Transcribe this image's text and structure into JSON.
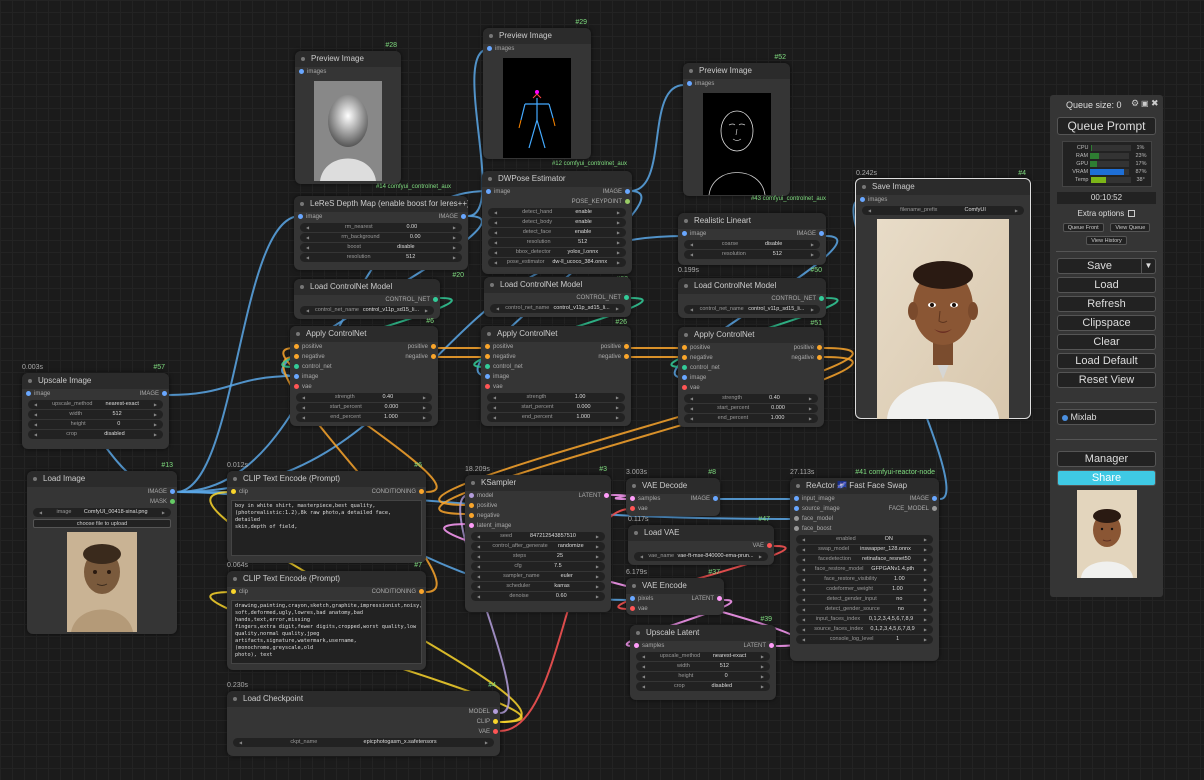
{
  "nodes": {
    "preview28": {
      "id": "#28",
      "title": "Preview Image",
      "input": "images",
      "footer": "#14 comfyui_controlnet_aux"
    },
    "preview29": {
      "id": "#29",
      "title": "Preview Image",
      "input": "images",
      "footer": "#12 comfyui_controlnet_aux"
    },
    "preview52": {
      "id": "#52",
      "title": "Preview Image",
      "input": "images",
      "footer": "#43 comfyui_controlnet_aux"
    },
    "leres": {
      "id": "#20",
      "title": "LeReS Depth Map (enable boost for leres++)",
      "input": "image",
      "output": "IMAGE",
      "widgets": [
        [
          "rm_nearest",
          "0.00"
        ],
        [
          "rm_background",
          "0.00"
        ],
        [
          "boost",
          "disable"
        ],
        [
          "resolution",
          "512"
        ]
      ]
    },
    "dwpose": {
      "id": "#22",
      "title": "DWPose Estimator",
      "input": "image",
      "outputs": [
        "IMAGE",
        "POSE_KEYPOINT"
      ],
      "widgets": [
        [
          "detect_hand",
          "enable"
        ],
        [
          "detect_body",
          "enable"
        ],
        [
          "detect_face",
          "enable"
        ],
        [
          "resolution",
          "512"
        ],
        [
          "bbox_detector",
          "yolox_l.onnx"
        ],
        [
          "pose_estimator",
          "dw-ll_ucoco_384.onnx"
        ]
      ]
    },
    "lineart": {
      "id": "#50",
      "time": "0.199s",
      "title": "Realistic Lineart",
      "input": "image",
      "output": "IMAGE",
      "widgets": [
        [
          "coarse",
          "disable"
        ],
        [
          "resolution",
          "512"
        ]
      ]
    },
    "cnload1": {
      "id": "#26",
      "title": "Load ControlNet Model",
      "output": "CONTROL_NET",
      "widget": [
        "control_net_name",
        "control_v11p_sd15_li..."
      ]
    },
    "cnload2": {
      "id": "#26",
      "title": "Load ControlNet Model",
      "output": "CONTROL_NET",
      "widget": [
        "control_net_name",
        "control_v11p_sd15_li..."
      ]
    },
    "cnload3": {
      "id": "#51",
      "title": "Load ControlNet Model",
      "output": "CONTROL_NET",
      "widget": [
        "control_net_name",
        "control_v11p_sd15_li..."
      ]
    },
    "apply1": {
      "id": "#6",
      "title": "Apply ControlNet",
      "inputs": [
        "positive",
        "negative",
        "control_net",
        "image",
        "vae"
      ],
      "outputs": [
        "positive",
        "negative"
      ],
      "widgets": [
        [
          "strength",
          "0.40"
        ],
        [
          "start_percent",
          "0.000"
        ],
        [
          "end_percent",
          "1.000"
        ]
      ]
    },
    "apply2": {
      "id": "#3",
      "title": "Apply ControlNet",
      "inputs": [
        "positive",
        "negative",
        "control_net",
        "image",
        "vae"
      ],
      "outputs": [
        "positive",
        "negative"
      ],
      "widgets": [
        [
          "strength",
          "1.00"
        ],
        [
          "start_percent",
          "0.000"
        ],
        [
          "end_percent",
          "1.000"
        ]
      ]
    },
    "apply3": {
      "id": "#8",
      "title": "Apply ControlNet",
      "inputs": [
        "positive",
        "negative",
        "control_net",
        "image",
        "vae"
      ],
      "outputs": [
        "positive",
        "negative"
      ],
      "widgets": [
        [
          "strength",
          "0.40"
        ],
        [
          "start_percent",
          "0.000"
        ],
        [
          "end_percent",
          "1.000"
        ]
      ]
    },
    "upscale": {
      "id": "#57",
      "time": "0.003s",
      "title": "Upscale Image",
      "input": "image",
      "output": "IMAGE",
      "widgets": [
        [
          "upscale_method",
          "nearest-exact"
        ],
        [
          "width",
          "512"
        ],
        [
          "height",
          "0"
        ],
        [
          "crop",
          "disabled"
        ]
      ]
    },
    "loadimg": {
      "id": "#13",
      "title": "Load Image",
      "outputs": [
        "IMAGE",
        "MASK"
      ],
      "widget": [
        "image",
        "ComfyUI_00418-sinal.png"
      ],
      "button": "choose file to upload"
    },
    "clip1": {
      "id": "#6",
      "time": "0.012s",
      "title": "CLIP Text Encode (Prompt)",
      "input": "clip",
      "output": "CONDITIONING",
      "text": "boy in white shirt, masterpiece,best quality,\n(photorealistic:1.2),8k raw photo,a detailed face, detailed\nskin,depth of field,"
    },
    "clip2": {
      "id": "#7",
      "time": "0.064s",
      "title": "CLIP Text Encode (Prompt)",
      "input": "clip",
      "output": "CONDITIONING",
      "text": "drawing,painting,crayon,sketch,graphite,impressionist,noisy,blurry,\nsoft,deformed,ugly,lowres,bad anatomy,bad hands,text,error,missing\nfingers,extra digit,fewer digits,cropped,worst quality,low\nquality,normal quality,jpeg\nartifacts,signature,watermark,username,(monochrome,greyscale,old\nphoto), text"
    },
    "ckpt": {
      "id": "#4",
      "time": "0.230s",
      "title": "Load Checkpoint",
      "outputs": [
        "MODEL",
        "CLIP",
        "VAE"
      ],
      "widget": [
        "ckpt_name",
        "epicphotogasm_x.safetensors"
      ]
    },
    "ksampler": {
      "id": "#3",
      "time": "18.209s",
      "title": "KSampler",
      "inputs": [
        "model",
        "positive",
        "negative",
        "latent_image"
      ],
      "output": "LATENT",
      "widgets": [
        [
          "seed",
          "847212543857510"
        ],
        [
          "control_after_generate",
          "randomize"
        ],
        [
          "steps",
          "25"
        ],
        [
          "cfg",
          "7.5"
        ],
        [
          "sampler_name",
          "euler"
        ],
        [
          "scheduler",
          "karras"
        ],
        [
          "denoise",
          "0.60"
        ]
      ]
    },
    "vaedec": {
      "id": "#8",
      "time": "3.003s",
      "title": "VAE Decode",
      "inputs": [
        "samples",
        "vae"
      ],
      "output": "IMAGE"
    },
    "loadvae": {
      "id": "#47",
      "time": "0.117s",
      "title": "Load VAE",
      "output": "VAE",
      "widget": [
        "vae_name",
        "vae-ft-mse-840000-ema-prun..."
      ]
    },
    "vaeenc": {
      "id": "#37",
      "time": "6.179s",
      "title": "VAE Encode",
      "inputs": [
        "pixels",
        "vae"
      ],
      "output": "LATENT"
    },
    "uplatent": {
      "id": "#39",
      "title": "Upscale Latent",
      "input": "samples",
      "output": "LATENT",
      "widgets": [
        [
          "upscale_method",
          "nearest-exact"
        ],
        [
          "width",
          "512"
        ],
        [
          "height",
          "0"
        ],
        [
          "crop",
          "disabled"
        ]
      ]
    },
    "reactor": {
      "id": "#41 comfyui-reactor-node",
      "time": "27.113s",
      "title": "ReActor 🌌 Fast Face Swap",
      "inputs": [
        "input_image",
        "source_image",
        "face_model",
        "face_boost"
      ],
      "outputs": [
        "IMAGE",
        "FACE_MODEL"
      ],
      "widgets": [
        [
          "enabled",
          "ON"
        ],
        [
          "swap_model",
          "inswapper_128.onnx"
        ],
        [
          "facedetection",
          "retinaface_resnet50"
        ],
        [
          "face_restore_model",
          "GFPGANv1.4.pth"
        ],
        [
          "face_restore_visibility",
          "1.00"
        ],
        [
          "codeformer_weight",
          "1.00"
        ],
        [
          "detect_gender_input",
          "no"
        ],
        [
          "detect_gender_source",
          "no"
        ],
        [
          "input_faces_index",
          "0,1,2,3,4,5,6,7,8,9"
        ],
        [
          "source_faces_index",
          "0,1,2,3,4,5,6,7,8,9"
        ],
        [
          "console_log_level",
          "1"
        ]
      ]
    },
    "save": {
      "id": "#4",
      "time": "0.242s",
      "title": "Save Image",
      "input": "images",
      "widget": [
        "filename_prefix",
        "ComfyUI"
      ]
    }
  },
  "panel": {
    "queue_label": "Queue size: 0",
    "queue_button": "Queue Prompt",
    "stats": [
      {
        "label": "CPU",
        "value": "1%",
        "fill": 0.01,
        "color": "#2e7d32"
      },
      {
        "label": "RAM",
        "value": "23%",
        "fill": 0.23,
        "color": "#2e7d32"
      },
      {
        "label": "GPU",
        "value": "17%",
        "fill": 0.17,
        "color": "#2e7d32"
      },
      {
        "label": "VRAM",
        "value": "87%",
        "fill": 0.87,
        "color": "#1e6fd6"
      },
      {
        "label": "Temp",
        "value": "38°",
        "fill": 0.38,
        "color": "#7cb518"
      }
    ],
    "timer": "00:10:52",
    "extra_options": "Extra options",
    "queue_front": "Queue Front",
    "view_queue": "View Queue",
    "view_history": "View History",
    "save": "Save",
    "load": "Load",
    "refresh": "Refresh",
    "clipspace": "Clipspace",
    "clear": "Clear",
    "load_default": "Load Default",
    "reset_view": "Reset View",
    "mixlab": "Mixlab",
    "manager": "Manager",
    "share": "Share",
    "share_color": "#3fc9e4"
  }
}
